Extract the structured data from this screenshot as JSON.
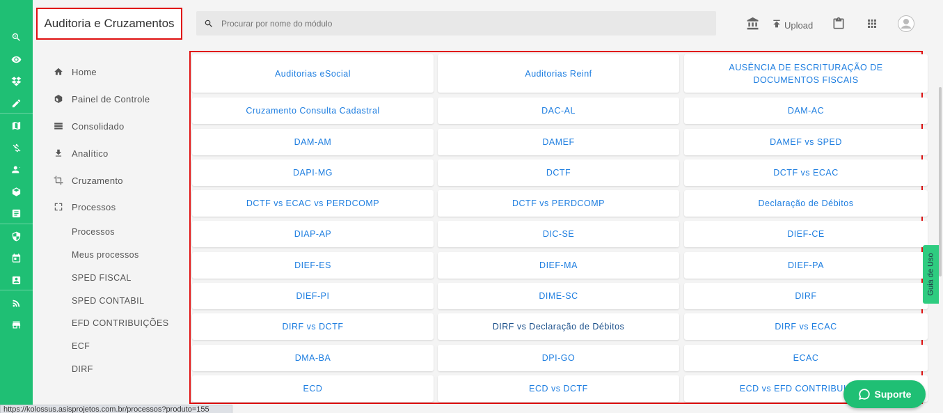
{
  "header": {
    "module_title": "Auditoria e Cruzamentos",
    "search_placeholder": "Procurar por nome do módulo",
    "upload_label": "Upload"
  },
  "nav": {
    "items": [
      {
        "label": "Home",
        "icon": "home-icon"
      },
      {
        "label": "Painel de Controle",
        "icon": "dashboard-icon"
      },
      {
        "label": "Consolidado",
        "icon": "table-icon"
      },
      {
        "label": "Analítico",
        "icon": "download-icon"
      },
      {
        "label": "Cruzamento",
        "icon": "crop-icon"
      },
      {
        "label": "Processos",
        "icon": "expand-icon"
      }
    ],
    "sub_items": [
      "Processos",
      "Meus processos",
      "SPED FISCAL",
      "SPED CONTABIL",
      "EFD CONTRIBUIÇÕES",
      "ECF",
      "DIRF"
    ]
  },
  "modules": [
    "Auditorias eSocial",
    "Auditorias Reinf",
    "AUSÊNCIA DE ESCRITURAÇÃO DE DOCUMENTOS FISCAIS",
    "Cruzamento Consulta Cadastral",
    "DAC-AL",
    "DAM-AC",
    "DAM-AM",
    "DAMEF",
    "DAMEF vs SPED",
    "DAPI-MG",
    "DCTF",
    "DCTF vs ECAC",
    "DCTF vs ECAC vs PERDCOMP",
    "DCTF vs PERDCOMP",
    "Declaração de Débitos",
    "DIAP-AP",
    "DIC-SE",
    "DIEF-CE",
    "DIEF-ES",
    "DIEF-MA",
    "DIEF-PA",
    "DIEF-PI",
    "DIME-SC",
    "DIRF",
    "DIRF vs DCTF",
    "DIRF vs Declaração de Débitos",
    "DIRF vs ECAC",
    "DMA-BA",
    "DPI-GO",
    "ECAC",
    "ECD",
    "ECD vs DCTF",
    "ECD vs EFD CONTRIBUIÇÕES"
  ],
  "guide_tab": "Guia de Uso",
  "support_label": "Suporte",
  "status_url": "https://kolossus.asisprojetos.com.br/processos?produto=155",
  "colors": {
    "rail": "#1fbf74",
    "link": "#1e7ee0",
    "highlight_border": "#e01010"
  }
}
